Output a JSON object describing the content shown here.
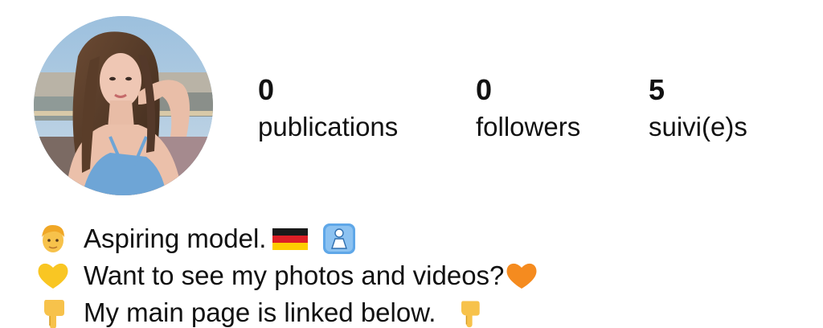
{
  "profile": {
    "stats": {
      "posts": {
        "count": "0",
        "label": "publications"
      },
      "followers": {
        "count": "0",
        "label": "followers"
      },
      "following": {
        "count": "5",
        "label": "suivi(e)s"
      }
    },
    "bio": {
      "line1": {
        "text": "Aspiring model.",
        "emoji_lead": "person-blond-hair-emoji",
        "emoji_after": [
          "germany-flag-emoji",
          "womens-room-emoji"
        ]
      },
      "line2": {
        "text": "Want to see my photos and videos?",
        "emoji_lead": "yellow-heart-emoji",
        "emoji_after": [
          "orange-heart-emoji"
        ]
      },
      "line3": {
        "text": "My main page is linked below.",
        "emoji_lead": "pointing-down-emoji",
        "emoji_after": [
          "pointing-down-emoji"
        ]
      }
    }
  },
  "colors": {
    "text": "#111111",
    "background": "#ffffff"
  }
}
